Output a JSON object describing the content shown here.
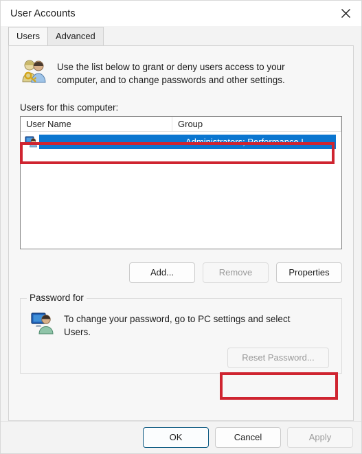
{
  "window": {
    "title": "User Accounts",
    "close_icon": "close-icon"
  },
  "tabs": [
    {
      "label": "Users",
      "active": true
    },
    {
      "label": "Advanced",
      "active": false
    }
  ],
  "users_tab": {
    "intro_icon": "two-users-with-key-icon",
    "intro_text": "Use the list below to grant or deny users access to your computer, and to change passwords and other settings.",
    "list_label": "Users for this computer:",
    "list": {
      "columns": [
        "User Name",
        "Group"
      ],
      "rows": [
        {
          "icon": "user-account-icon",
          "user_name": "",
          "group": "Administrators; Performance L...",
          "selected": true
        }
      ]
    },
    "buttons": [
      {
        "label": "Add...",
        "enabled": true
      },
      {
        "label": "Remove",
        "enabled": false
      },
      {
        "label": "Properties",
        "enabled": true
      }
    ],
    "password_group": {
      "legend": "Password for",
      "icon": "user-at-computer-icon",
      "text": "To change your password, go to PC settings and select Users.",
      "reset_button": {
        "label": "Reset Password...",
        "enabled": false
      }
    }
  },
  "footer": {
    "buttons": [
      {
        "label": "OK",
        "enabled": true,
        "default": true
      },
      {
        "label": "Cancel",
        "enabled": true,
        "default": false
      },
      {
        "label": "Apply",
        "enabled": false,
        "default": false
      }
    ]
  },
  "annotations": {
    "highlight_color": "#cf2430",
    "selection_color": "#0b76d0",
    "boxes": [
      {
        "name": "selected-user-row-highlight"
      },
      {
        "name": "reset-password-highlight"
      }
    ]
  }
}
